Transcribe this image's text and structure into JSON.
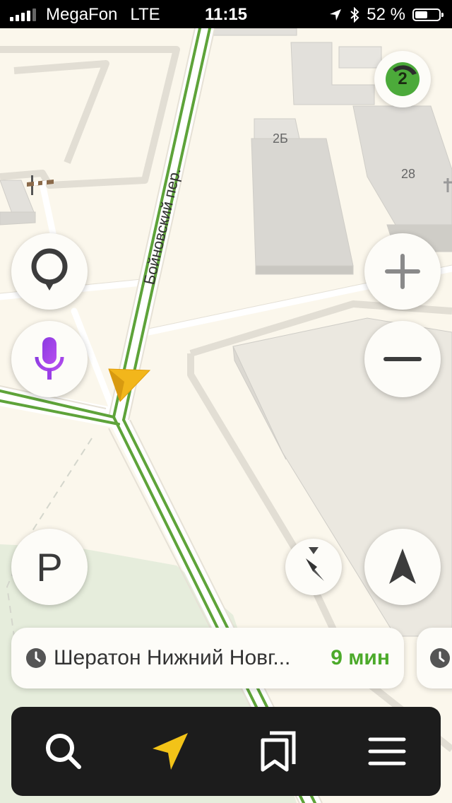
{
  "status_bar": {
    "carrier": "MegaFon",
    "network": "LTE",
    "time": "11:15",
    "battery": "52 %",
    "battery_level": 0.52
  },
  "map": {
    "street_label": "Бойновский пер.",
    "building_labels": [
      "2Б",
      "28"
    ],
    "colors": {
      "background": "#fbf7ec",
      "route": "#5ea33a",
      "road": "#ffffff",
      "building": "#d9d7d2",
      "park": "#e6eddc",
      "cursor": "#f2b61b"
    }
  },
  "traffic_badge": {
    "value": "2",
    "color": "#4caa3a"
  },
  "controls": {
    "search_pin": "map-pin-icon",
    "voice": "microphone-icon",
    "zoom_in": "plus-icon",
    "zoom_out": "minus-icon",
    "parking": "P",
    "compass": "compass-icon",
    "locate": "navigation-arrow-icon"
  },
  "route_card": {
    "destination": "Шератон Нижний Новг...",
    "eta": "9 мин"
  },
  "bottom_nav": {
    "search": "search-icon",
    "navigator": "navigator-arrow-icon",
    "bookmarks": "bookmarks-icon",
    "menu": "menu-icon"
  }
}
